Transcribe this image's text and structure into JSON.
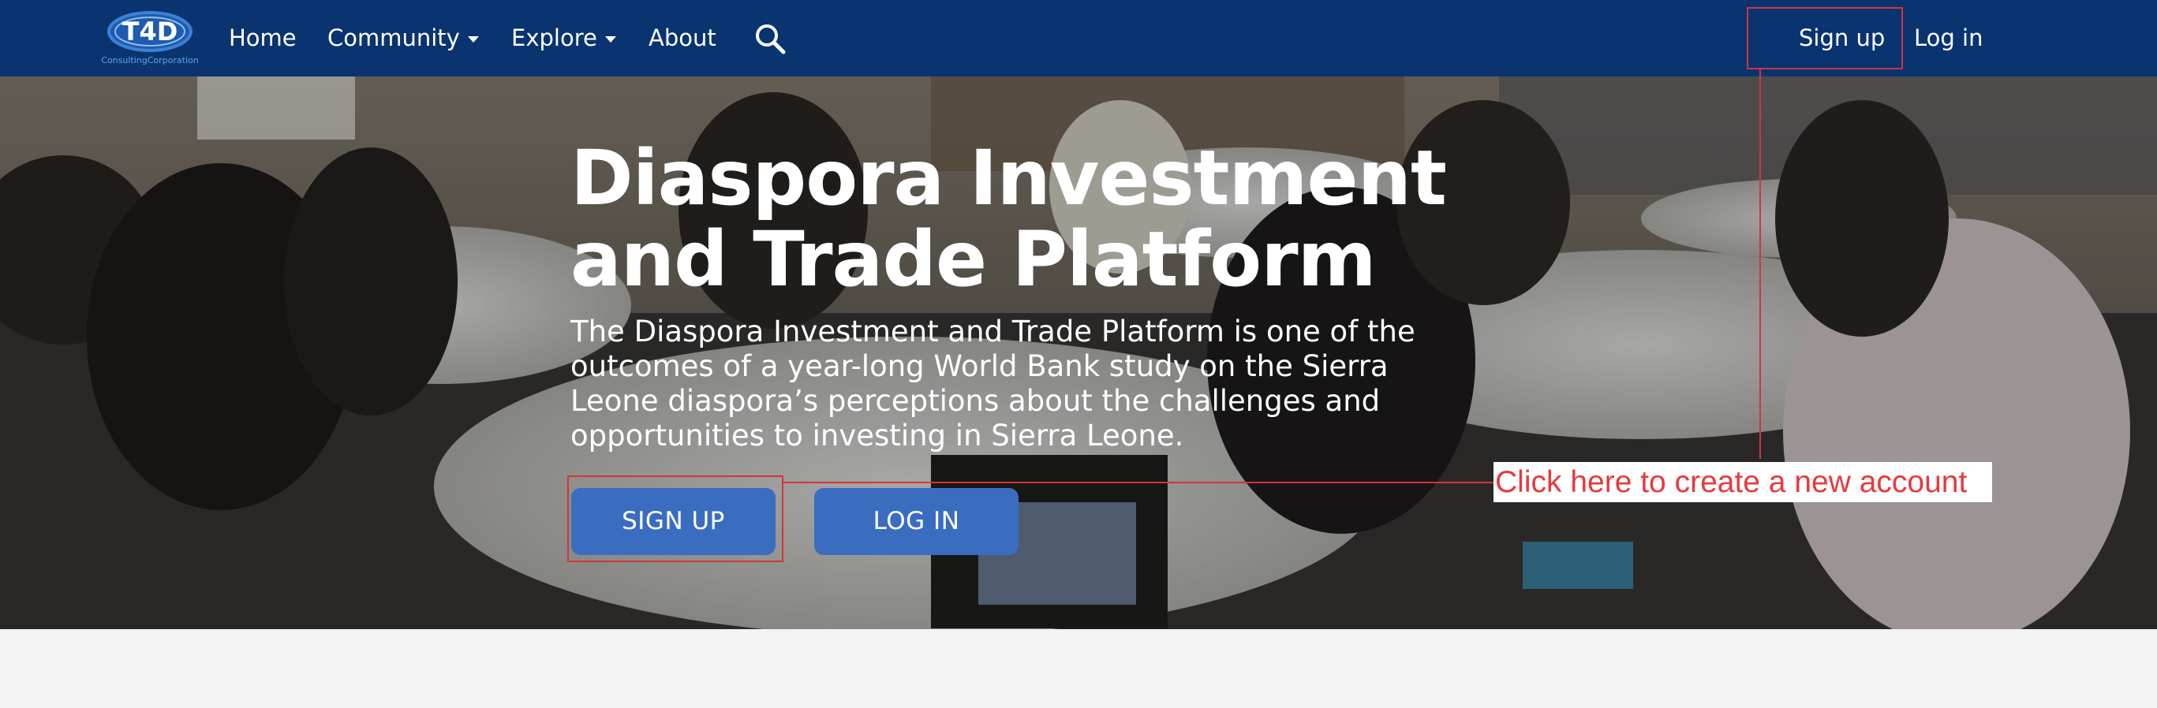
{
  "brand": {
    "logo_text": "T4D",
    "logo_subtext": "ConsultingCorporation",
    "colors": {
      "navbar": "#0a3470",
      "logo": "#3b82d6",
      "button": "#3a6dc0",
      "annotation": "#e8393c"
    }
  },
  "nav": {
    "items": [
      {
        "label": "Home",
        "has_dropdown": false
      },
      {
        "label": "Community",
        "has_dropdown": true
      },
      {
        "label": "Explore",
        "has_dropdown": true
      },
      {
        "label": "About",
        "has_dropdown": false
      }
    ],
    "search_icon": "search-icon",
    "signup_label": "Sign up",
    "login_label": "Log in"
  },
  "hero": {
    "title_line1": "Diaspora Investment",
    "title_line2": "and Trade Platform",
    "description_lines": [
      "The Diaspora Investment and Trade Platform is one of the",
      "outcomes of a year-long World Bank study on the Sierra",
      "Leone diaspora’s perceptions about the challenges and",
      "opportunities to investing in Sierra Leone."
    ],
    "signup_button": "SIGN UP",
    "login_button": "LOG IN"
  },
  "annotation": {
    "text": "Click here to create a new account"
  }
}
